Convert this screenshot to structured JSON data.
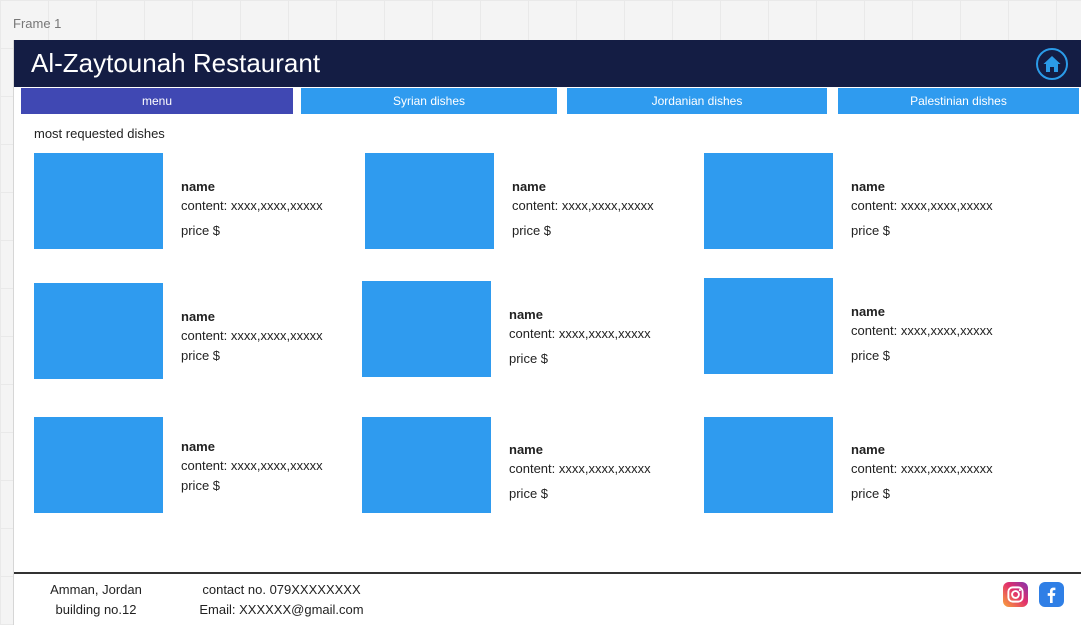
{
  "canvas": {
    "frame_label": "Frame 1"
  },
  "header": {
    "title": "Al-Zaytounah Restaurant",
    "home_icon": "home-icon"
  },
  "nav": {
    "tabs": [
      {
        "label": "menu",
        "active": true
      },
      {
        "label": "Syrian dishes",
        "active": false
      },
      {
        "label": "Jordanian dishes",
        "active": false
      },
      {
        "label": "Palestinian dishes",
        "active": false
      }
    ]
  },
  "main": {
    "section_title": "most requested dishes",
    "dishes": [
      {
        "name": "name",
        "content": "content: xxxx,xxxx,xxxxx",
        "price": "price $"
      },
      {
        "name": "name",
        "content": "content: xxxx,xxxx,xxxxx",
        "price": "price $"
      },
      {
        "name": "name",
        "content": "content: xxxx,xxxx,xxxxx",
        "price": "price $"
      },
      {
        "name": "name",
        "content": "content: xxxx,xxxx,xxxxx",
        "price": "price $"
      },
      {
        "name": "name",
        "content": "content: xxxx,xxxx,xxxxx",
        "price": "price $"
      },
      {
        "name": "name",
        "content": "content: xxxx,xxxx,xxxxx",
        "price": "price $"
      },
      {
        "name": "name",
        "content": "content: xxxx,xxxx,xxxxx",
        "price": "price $"
      },
      {
        "name": "name",
        "content": "content: xxxx,xxxx,xxxxx",
        "price": "price $"
      },
      {
        "name": "name",
        "content": "content: xxxx,xxxx,xxxxx",
        "price": "price $"
      }
    ]
  },
  "footer": {
    "address_line1": "Amman, Jordan",
    "address_line2": "building no.12",
    "contact_line1": "contact no. 079XXXXXXXX",
    "contact_line2": "Email: XXXXXX@gmail.com",
    "social": [
      "instagram-icon",
      "facebook-icon"
    ]
  },
  "colors": {
    "header_bg": "#141d44",
    "tab_bg": "#2f9bef",
    "tab_active_bg": "#4048b3",
    "image_placeholder": "#2f9bef"
  }
}
